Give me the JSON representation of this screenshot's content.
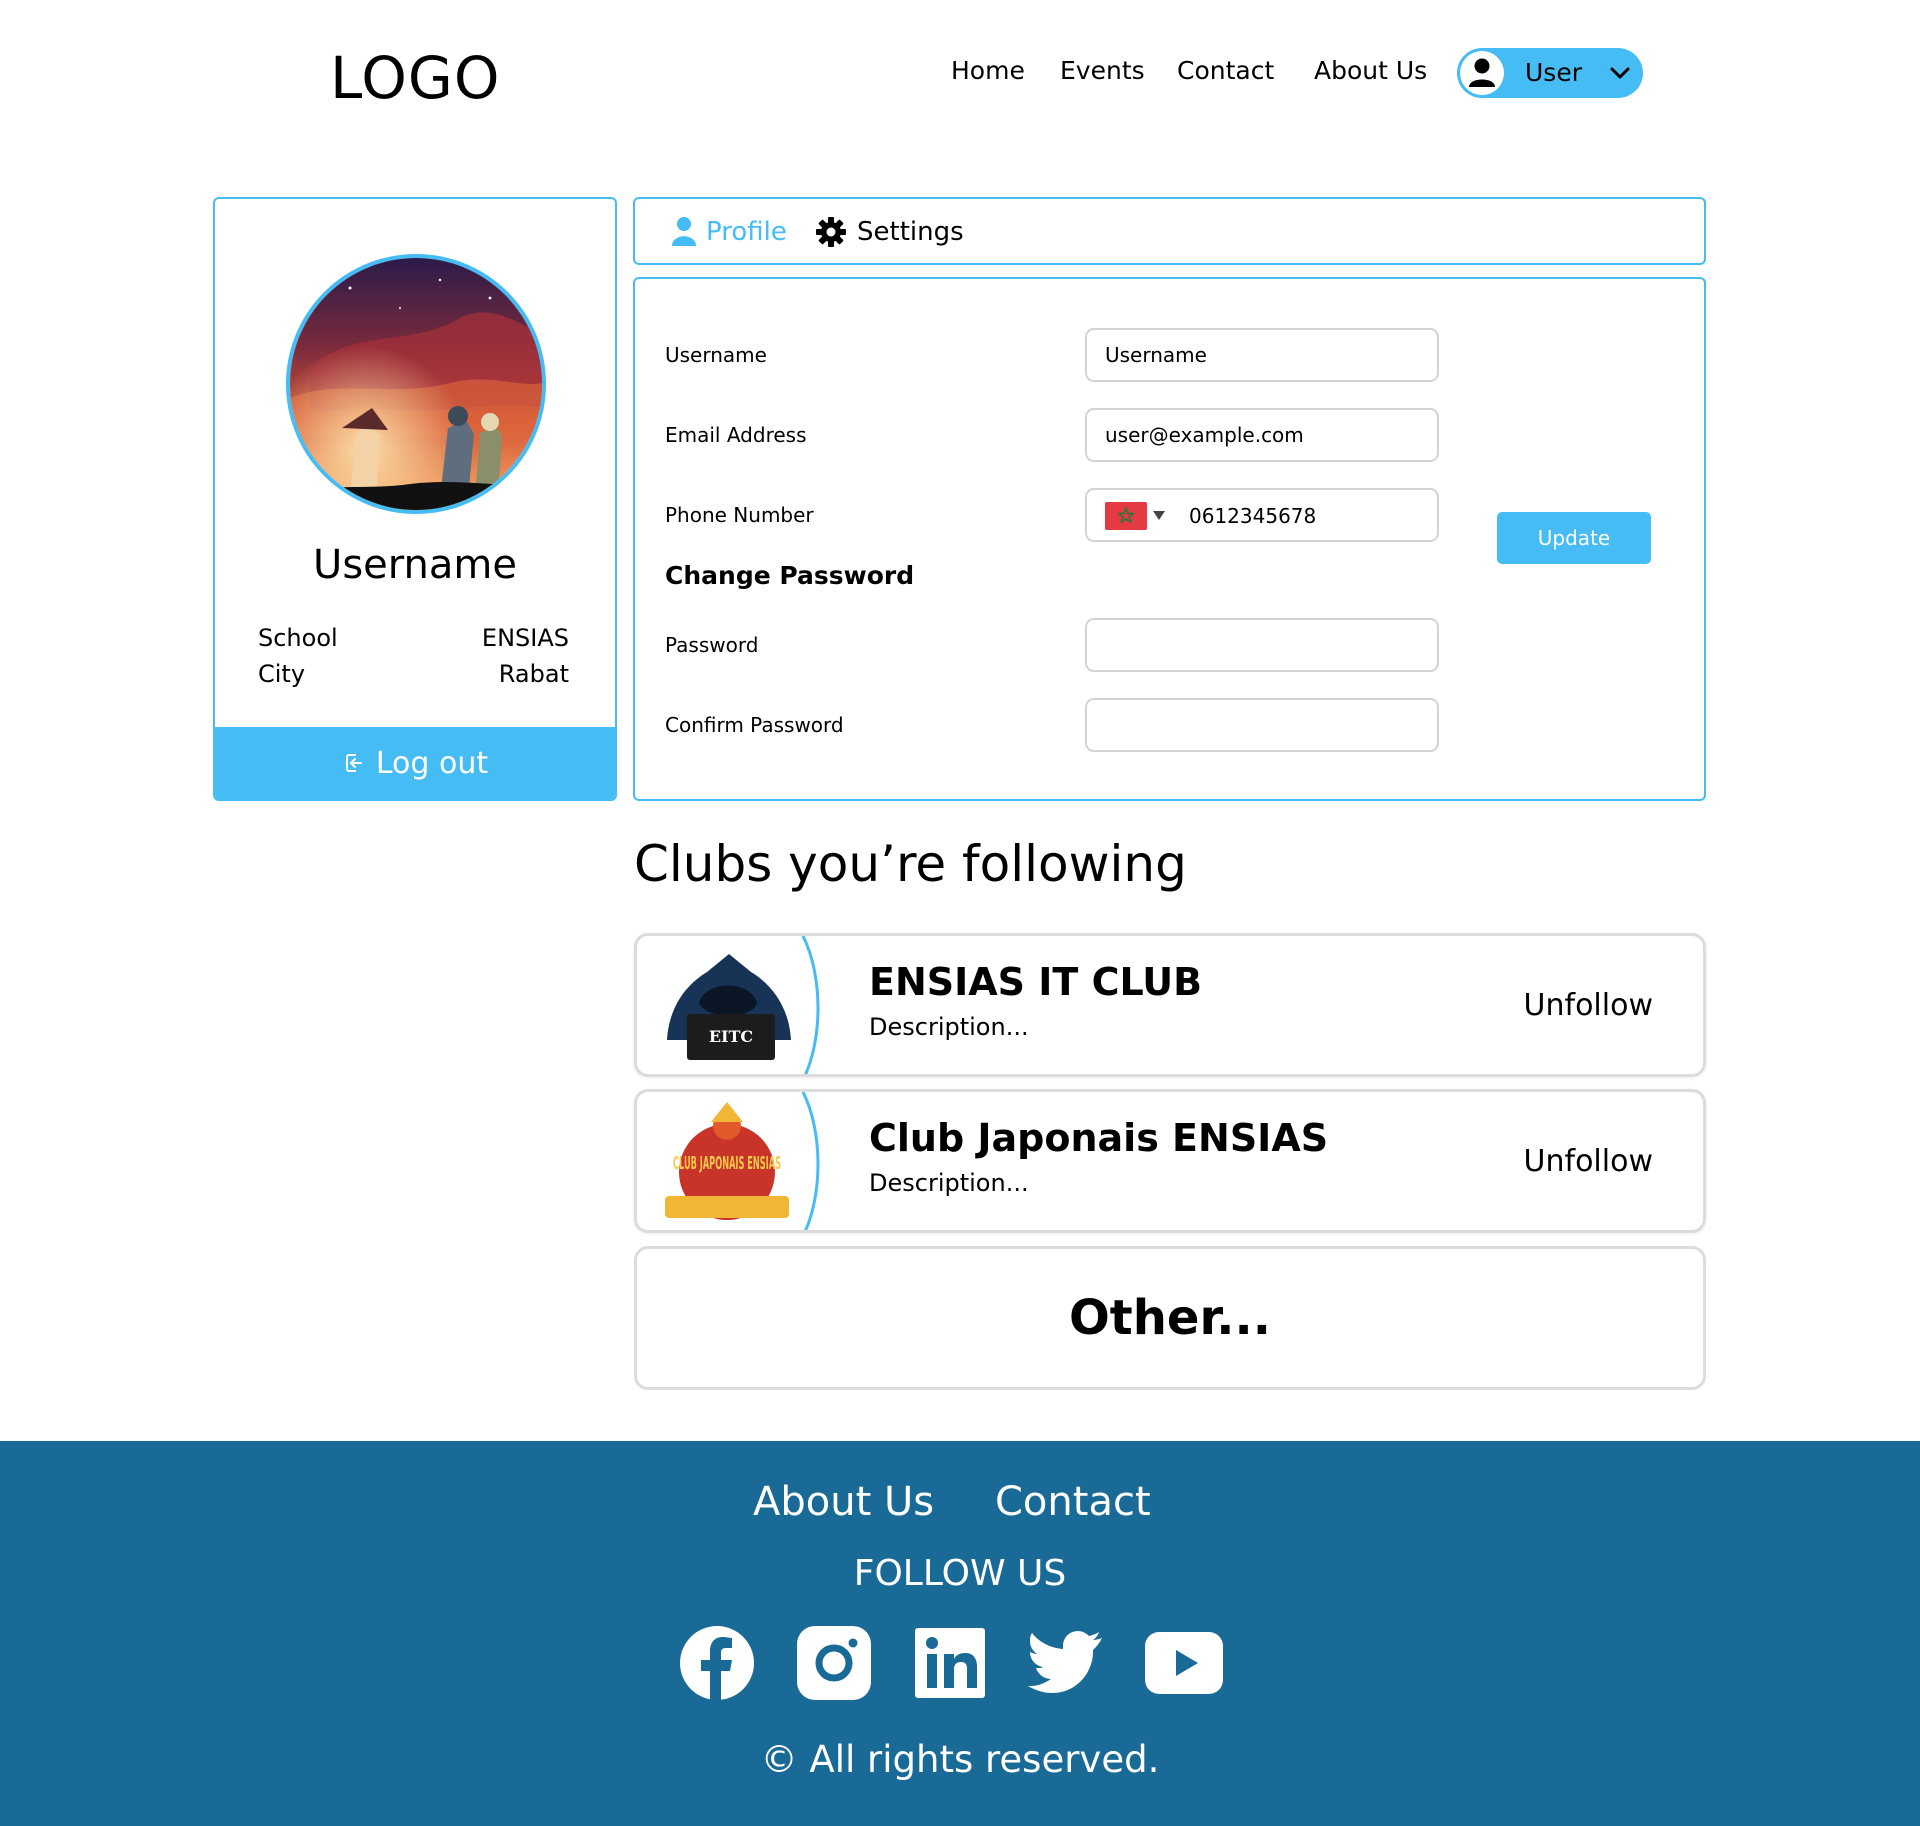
{
  "header": {
    "logo": "LOGO",
    "nav": [
      "Home",
      "Events",
      "Contact",
      "About Us"
    ],
    "user_label": "User"
  },
  "profile": {
    "username": "Username",
    "info": [
      {
        "label": "School",
        "value": "ENSIAS"
      },
      {
        "label": "City",
        "value": "Rabat"
      }
    ],
    "logout_label": "Log out"
  },
  "tabs": {
    "profile": "Profile",
    "settings": "Settings"
  },
  "form": {
    "username_label": "Username",
    "username_value": "Username",
    "email_label": "Email Address",
    "email_value": "user@example.com",
    "phone_label": "Phone Number",
    "phone_value": "0612345678",
    "change_password": "Change Password",
    "password_label": "Password",
    "password_value": "",
    "confirm_label": "Confirm Password",
    "confirm_value": "",
    "update_label": "Update"
  },
  "clubs": {
    "heading": "Clubs you’re following",
    "items": [
      {
        "name": "ENSIAS IT CLUB",
        "description": "Description...",
        "action": "Unfollow",
        "logo_text": "EITC"
      },
      {
        "name": "Club Japonais ENSIAS",
        "description": "Description...",
        "action": "Unfollow",
        "logo_text": "CLUB JAPONAIS ENSIAS"
      }
    ],
    "other": "Other..."
  },
  "footer": {
    "links": [
      "About Us",
      "Contact"
    ],
    "follow_us": "FOLLOW US",
    "social": [
      "facebook-icon",
      "instagram-icon",
      "linkedin-icon",
      "twitter-icon",
      "youtube-icon"
    ],
    "copyright": "© All rights reserved."
  },
  "colors": {
    "accent": "#45bcf4",
    "footer_bg": "#196a96",
    "border_gray": "#dcdcdc"
  }
}
